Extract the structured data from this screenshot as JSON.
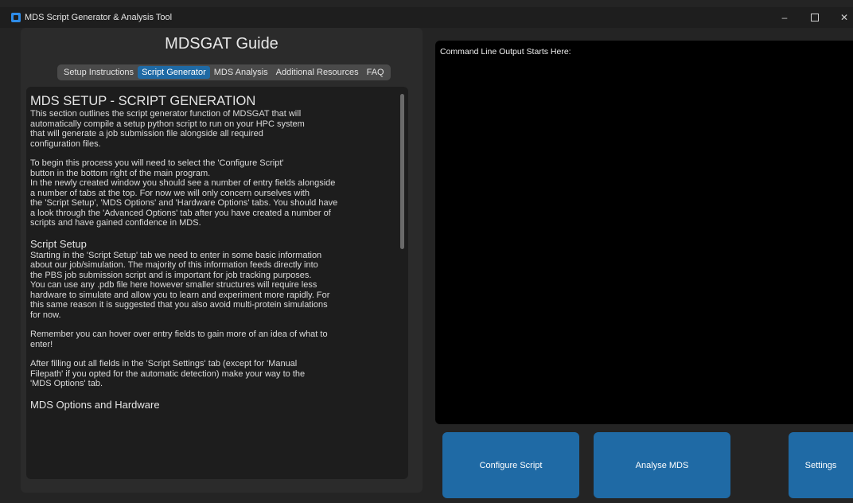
{
  "window": {
    "title": "MDS Script Generator & Analysis Tool",
    "controls": {
      "minimize": "–",
      "maximize": "□",
      "close": "✕"
    }
  },
  "guide": {
    "title": "MDSGAT Guide",
    "tabs": [
      "Setup Instructions",
      "Script Generator",
      "MDS Analysis",
      "Additional Resources",
      "FAQ"
    ],
    "active_tab": "Script Generator",
    "heading": "MDS SETUP - SCRIPT GENERATION",
    "paragraphs": [
      "This section outlines the script generator function of MDSGAT that will\nautomatically compile a setup python script to run on your HPC system\nthat will generate a job submission file alongside all required\nconfiguration files.",
      "To begin this process you will need to select the 'Configure Script'\nbutton in the bottom right of the main program.\nIn the newly created window you should see a number of entry fields alongside\na number of tabs at the top. For now we will only concern ourselves with\nthe 'Script Setup', 'MDS Options' and 'Hardware Options' tabs. You should have\na look through the 'Advanced Options' tab after you have created a number of\nscripts and have gained confidence in MDS."
    ],
    "section_script_setup": "Script Setup",
    "script_setup_paragraphs": [
      "Starting in the 'Script Setup' tab we need to enter in some basic information\nabout our job/simulation. The majority of this information feeds directly into\nthe PBS job submission script and is important for job tracking purposes.\nYou can use any .pdb file here however smaller structures will require less\nhardware to simulate and allow you to learn and experiment more rapidly. For\nthis same reason it is suggested that you also avoid multi-protein simulations\nfor now.",
      "Remember you can hover over entry fields to gain more of an idea of what to\nenter!",
      "After filling out all fields in the 'Script Settings' tab (except for 'Manual\nFilepath' if you opted for the automatic detection) make your way to the\n'MDS Options' tab."
    ],
    "section_mds_options": "MDS Options and Hardware"
  },
  "console": {
    "header": "Command Line Output Starts Here:"
  },
  "buttons": {
    "configure": "Configure Script",
    "analyse": "Analyse MDS",
    "settings": "Settings"
  },
  "colors": {
    "accent": "#1f6aa5",
    "background": "#242424",
    "panel": "#2b2b2b",
    "textbox": "#1d1d1d",
    "console": "#000000"
  }
}
